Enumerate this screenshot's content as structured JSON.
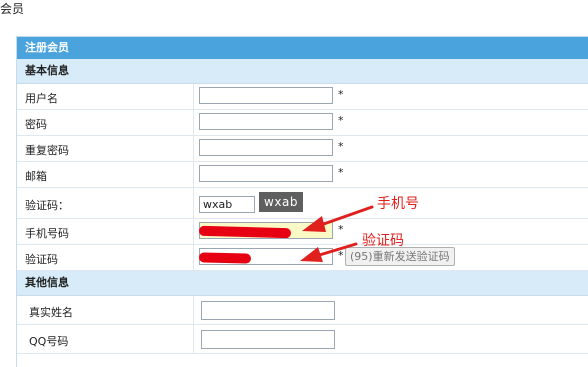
{
  "page": {
    "title": "会员"
  },
  "panel": {
    "header": "注册会员"
  },
  "sections": {
    "basic": "基本信息",
    "other": "其他信息"
  },
  "fields": {
    "username": {
      "label": "用户名",
      "value": "",
      "required": "*"
    },
    "password": {
      "label": "密码",
      "value": "",
      "required": "*"
    },
    "repeat_password": {
      "label": "重复密码",
      "value": "",
      "required": "*"
    },
    "email": {
      "label": "邮箱",
      "value": "",
      "required": "*"
    },
    "captcha": {
      "label": "验证码：",
      "value": "wxab",
      "captcha_text": "wxab"
    },
    "phone": {
      "label": "手机号码",
      "value": "",
      "required": "*"
    },
    "sms_code": {
      "label": "验证码",
      "value": "",
      "required": "*",
      "send_button": "(95)重新发送验证码"
    },
    "real_name": {
      "label": "真实姓名",
      "value": ""
    },
    "qq": {
      "label": "QQ号码",
      "value": ""
    }
  },
  "annotations": {
    "phone_note": "手机号",
    "code_note": "验证码",
    "color": "#e0201c"
  },
  "colors": {
    "header_bg": "#4aa3dc",
    "section_bg": "#d7ecf8",
    "highlight_field": "#fbf9c6",
    "redaction": "#e60012"
  }
}
